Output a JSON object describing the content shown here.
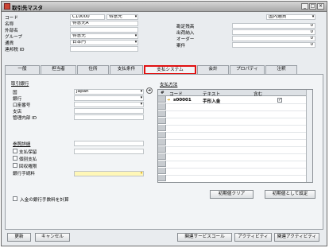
{
  "window": {
    "title": "取引先マスタ",
    "min": "_",
    "max": "□",
    "close": "×"
  },
  "header_left": {
    "code_label": "コード",
    "code_value": "C10000",
    "type_value": "得意先",
    "name_label": "名称",
    "name_value": "得意先A",
    "foreign_name_label": "外部名",
    "group_label": "グループ",
    "group_value": "得意先",
    "currency_label": "通貨",
    "currency_value": "日本円",
    "tax_id_label": "連邦税 ID"
  },
  "header_right": {
    "local_currency_value": "国内通貨",
    "balance_label": "勘定残高",
    "balance_value": "0",
    "shipments_label": "出荷納入",
    "shipments_value": "0",
    "orders_label": "オーダー",
    "orders_value": "0",
    "opportunities_label": "案件",
    "opportunities_value": "0"
  },
  "tabs": [
    "一般",
    "担当者",
    "住所",
    "支払条件",
    "支払システム",
    "会計",
    "プロパティ",
    "注釈"
  ],
  "left_panel": {
    "section_title": "取引銀行",
    "country_label": "国",
    "country_value": "Japan",
    "bank_label": "銀行",
    "account_label": "口座番号",
    "branch_label": "支店",
    "control_label": "管理内部 ID",
    "ref_title": "参照詳細",
    "payment_block_label": "支払保留",
    "single_payment_label": "個別支払",
    "collection_auth_label": "回収権限",
    "bank_charges_label": "銀行手続料",
    "include_charges_label": "入金の銀行手数料を計算"
  },
  "right_panel": {
    "section_title": "支払方法",
    "col_hash": "#",
    "col_code": "コード",
    "col_text": "テキスト",
    "col_include": "含む",
    "rows": [
      {
        "num": "1",
        "code": "s00001",
        "text": "手形入金",
        "include": "✓"
      }
    ],
    "clear_default_btn": "初期値クリア",
    "set_default_btn": "初期値として設定"
  },
  "footer": {
    "update_btn": "更新",
    "cancel_btn": "キャンセル",
    "related_service_btn": "関連サービスコール",
    "activity_btn": "アクティビティ",
    "related_activity_btn": "関連アクティビティ"
  }
}
